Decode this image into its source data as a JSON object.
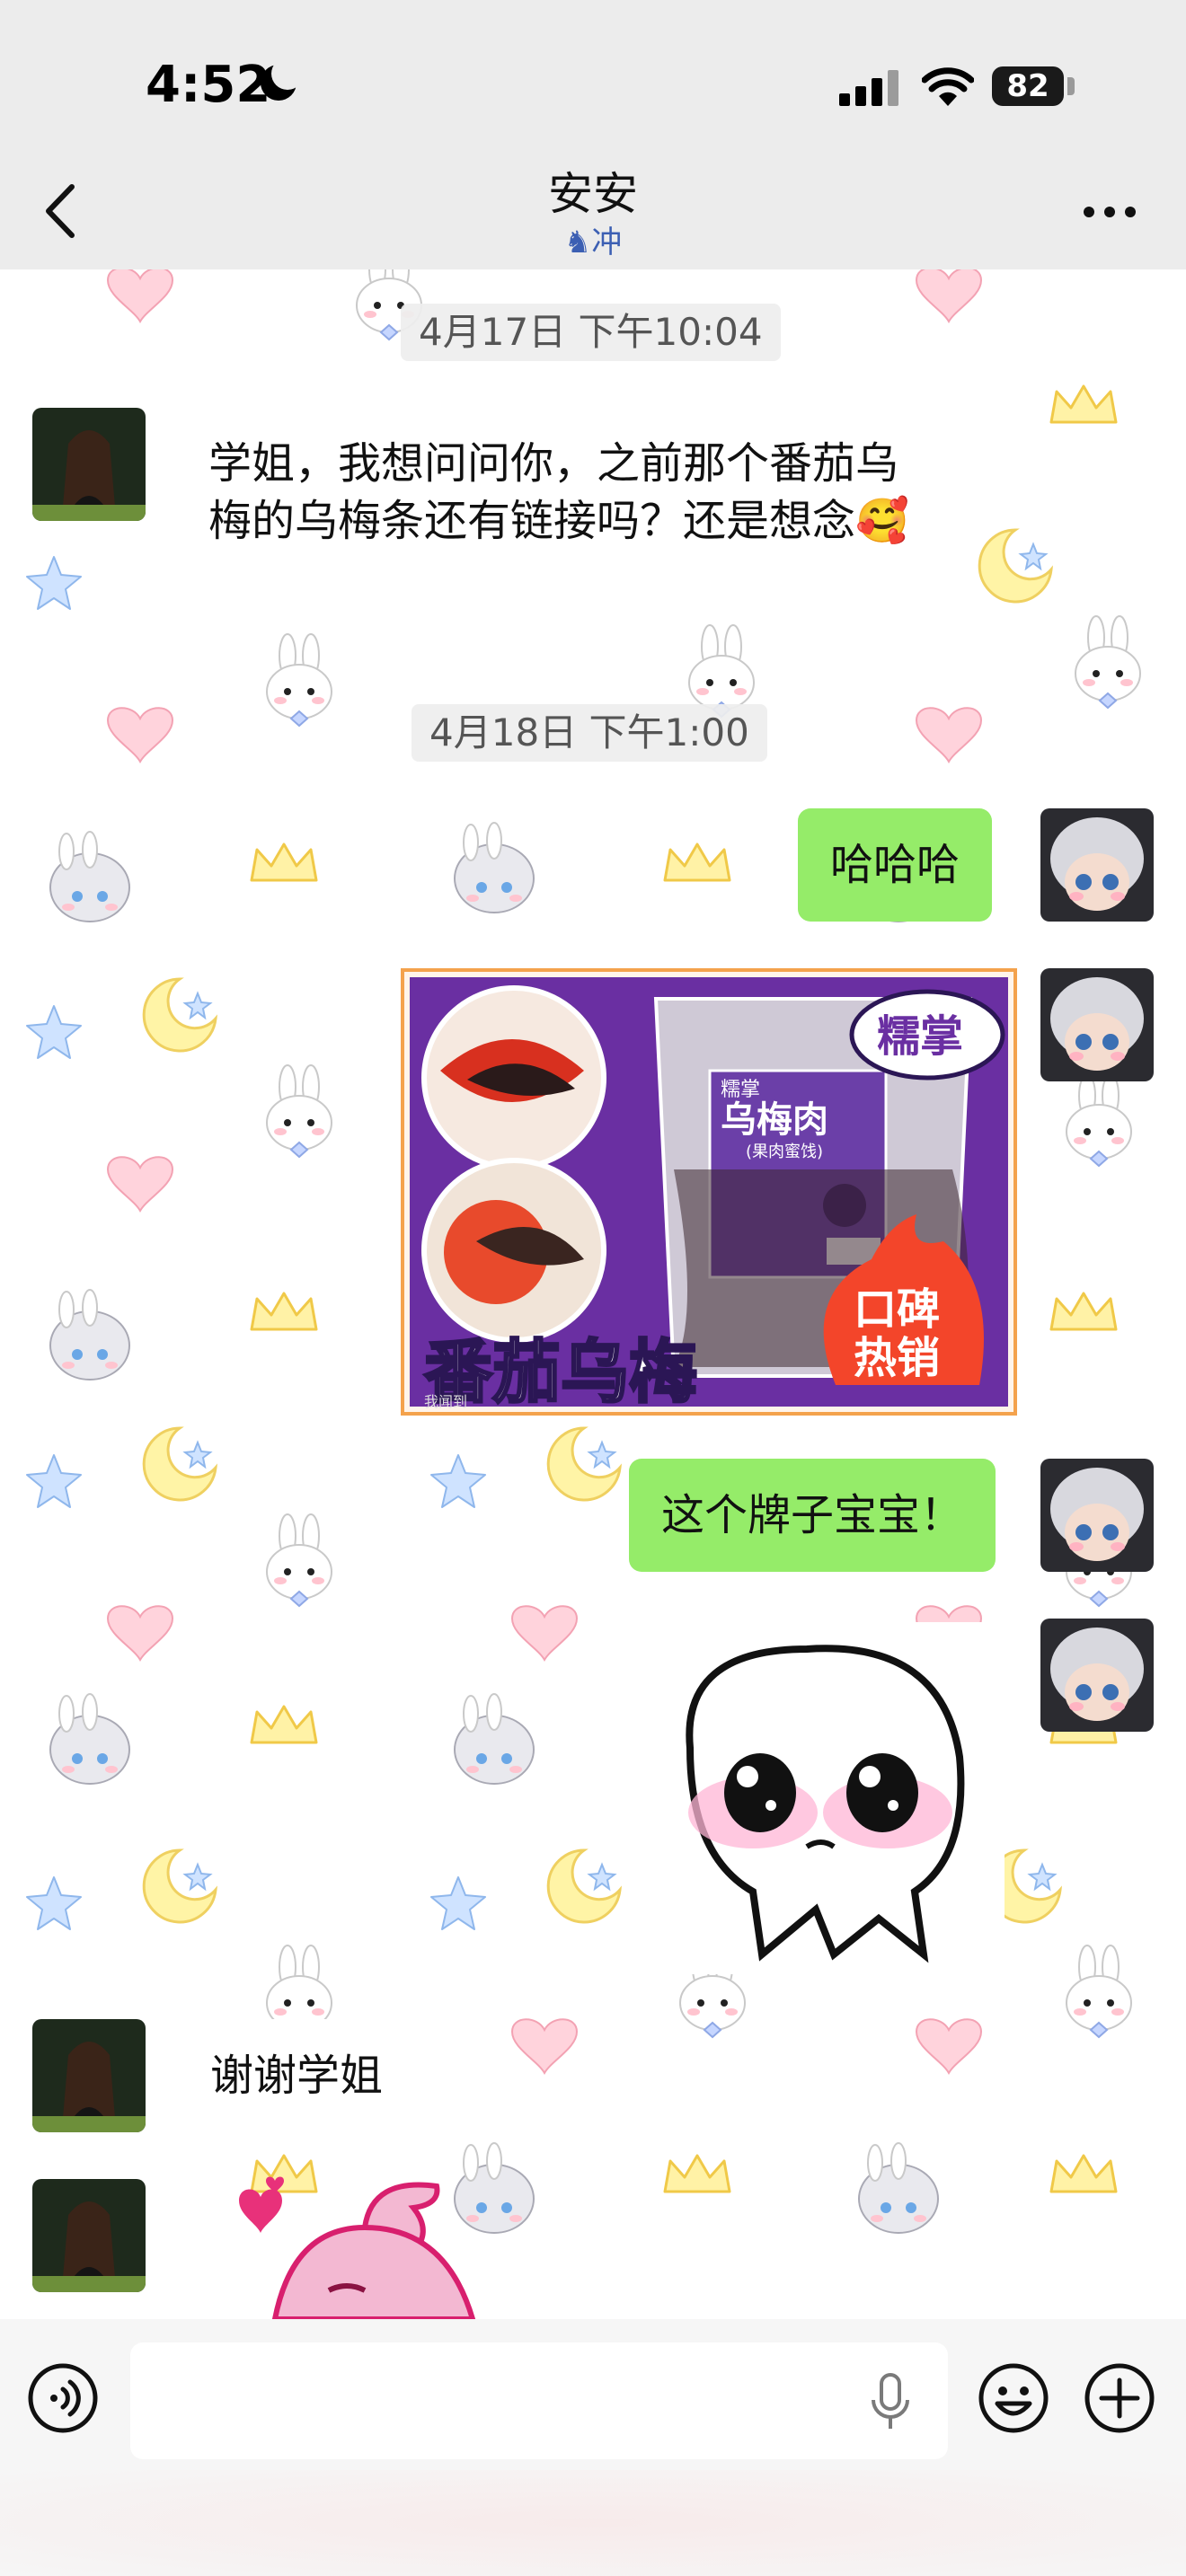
{
  "status_bar": {
    "time": "4:52",
    "battery": "82"
  },
  "nav": {
    "title": "安安",
    "subtitle": "冲"
  },
  "timestamps": [
    "4月17日 下午10:04",
    "4月18日 下午1:00"
  ],
  "messages": [
    {
      "side": "left",
      "text": "学姐，我想问问你，之前那个番茄乌梅的乌梅条还有链接吗？还是想念🥰"
    },
    {
      "side": "right",
      "text": "哈哈哈"
    },
    {
      "side": "right",
      "type": "image"
    },
    {
      "side": "right",
      "text": "这个牌子宝宝！"
    },
    {
      "side": "right",
      "type": "sticker"
    },
    {
      "side": "left",
      "text": "谢谢学姐"
    },
    {
      "side": "left",
      "type": "sticker"
    }
  ],
  "product_image": {
    "brand": "糯掌",
    "package_brand": "糯掌",
    "package_name": "乌梅肉",
    "package_sub": "(果肉蜜饯)",
    "headline": "番茄乌梅",
    "badge_top": "口碑",
    "badge_bottom": "热销",
    "watermark": "我闻到"
  },
  "icons": [
    "back-icon",
    "more-icon",
    "voice-icon",
    "mic-icon",
    "emoji-icon",
    "plus-icon",
    "signal-icon",
    "wifi-icon",
    "moon-icon"
  ],
  "colors": {
    "nav_bg": "#ececec",
    "bubble_right": "#95ec69",
    "bubble_left": "#ffffff",
    "accent_purple": "#6a2fa2"
  }
}
